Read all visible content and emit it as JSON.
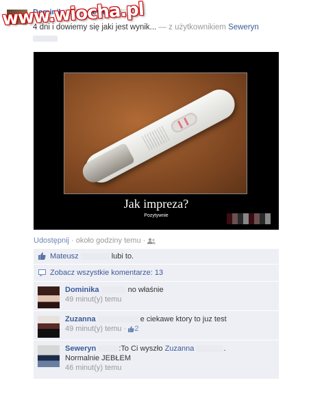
{
  "watermark": {
    "text": "www.wiocha.pl"
  },
  "post": {
    "author": "Dominik",
    "author_tagged": "Seweryn",
    "status_text": "4 dni i dowiemy się jaki jest wynik...",
    "with_prefix": "— z użytkownikiem",
    "with_user": "Seweryn"
  },
  "photo": {
    "caption": "Jak impreza?",
    "subcaption": "Pozytywnie"
  },
  "actions": {
    "share": "Udostępnij",
    "dot": "·",
    "time": "około godziny temu",
    "dot2": "·"
  },
  "likes": {
    "user": "Mateusz",
    "suffix": "lubi to."
  },
  "view_all": {
    "label": "Zobacz wszystkie komentarze: 13"
  },
  "comments": [
    {
      "name": "Dominika",
      "text": "no właśnie",
      "time": "49 minut(y) temu",
      "likes": ""
    },
    {
      "name": "Zuzanna",
      "text": "e ciekawe ktory to juz test",
      "time": "49 minut(y) temu",
      "dot": "·",
      "likes": "2"
    },
    {
      "name": "Seweryn",
      "text": ":To Ci wyszło",
      "mention": "Zuzanna",
      "period": ".",
      "text2": "Normalnie JEBŁEM",
      "time": "46 minut(y) temu",
      "likes": ""
    }
  ],
  "colors": {
    "link": "#3b5998",
    "feedback_bg": "#edeff4",
    "meta": "#999999"
  }
}
